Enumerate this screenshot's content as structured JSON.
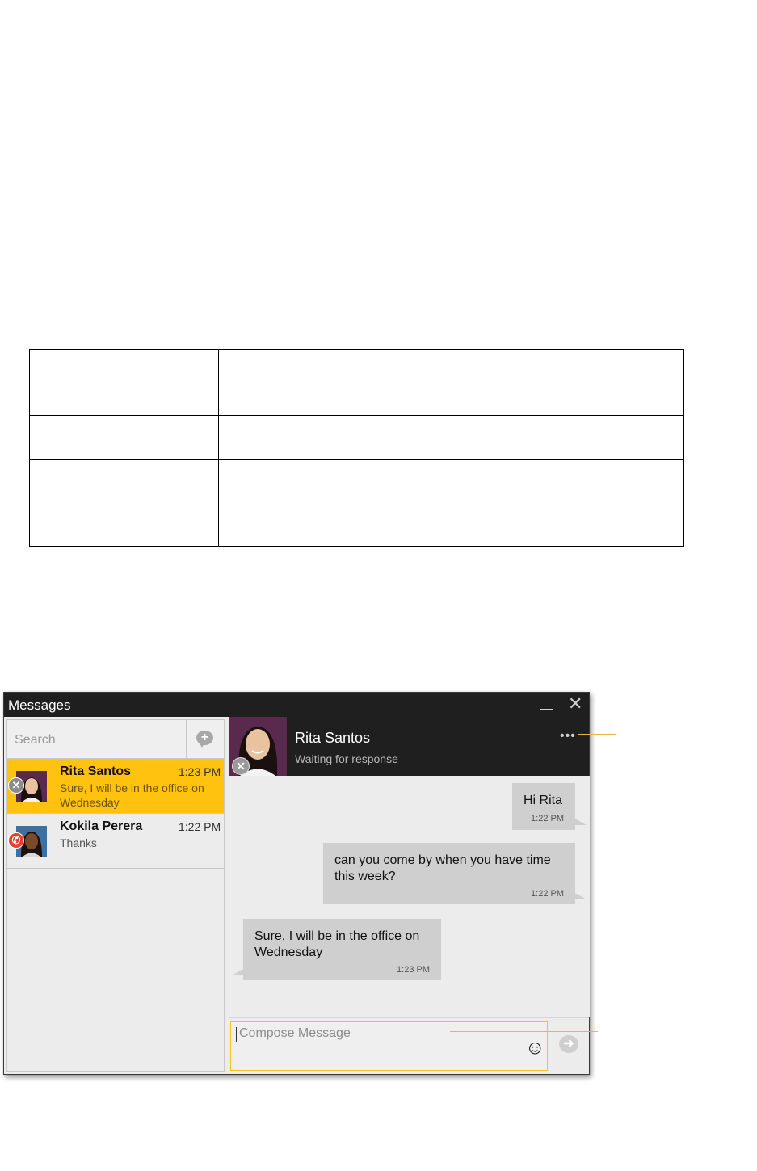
{
  "window": {
    "title": "Messages",
    "minimize_label": "minimize",
    "close_glyph": "✕"
  },
  "search": {
    "placeholder": "Search"
  },
  "new_message_glyph": "+",
  "conversations": [
    {
      "name": "Rita Santos",
      "time": "1:23 PM",
      "preview": "Sure, I will be in the office on Wednesday",
      "status_glyph": "✕",
      "selected": true
    },
    {
      "name": "Kokila Perera",
      "time": "1:22 PM",
      "preview": "Thanks",
      "status_glyph": "✆",
      "selected": false
    }
  ],
  "chat_header": {
    "name": "Rita Santos",
    "status_text": "Waiting for response",
    "status_glyph": "✕",
    "more_glyph": "•••"
  },
  "messages": [
    {
      "direction": "outgoing",
      "text": "Hi Rita",
      "time": "1:22 PM"
    },
    {
      "direction": "outgoing",
      "text": "can you come by when you have time this week?",
      "time": "1:22 PM"
    },
    {
      "direction": "incoming",
      "text": "Sure, I will be in the office on Wednesday",
      "time": "1:23 PM"
    }
  ],
  "compose": {
    "placeholder": "Compose Message",
    "emoji_glyph": "☺",
    "send_glyph": "➜"
  },
  "colors": {
    "accent": "#ffc20e",
    "titlebar": "#1f1f1f",
    "bubble": "#cfcfcf",
    "busy": "#e8402c"
  }
}
